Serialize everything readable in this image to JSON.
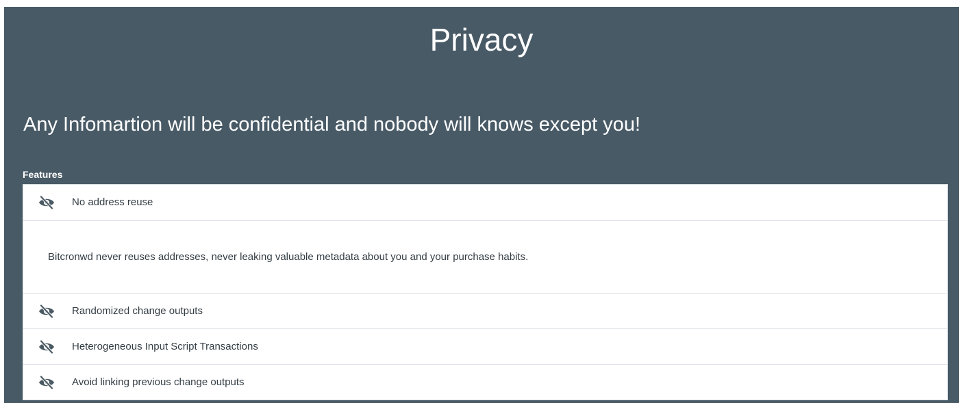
{
  "header": {
    "title": "Privacy",
    "subtitle": "Any Infomartion will be confidential and nobody will knows except you!"
  },
  "features": {
    "label": "Features",
    "icon": "eye-slash-icon",
    "items": [
      {
        "label": "No address reuse",
        "expanded": true,
        "description": "Bitcronwd never reuses addresses, never leaking valuable metadata about you and your purchase habits."
      },
      {
        "label": "Randomized change outputs",
        "expanded": false
      },
      {
        "label": "Heterogeneous Input Script Transactions",
        "expanded": false
      },
      {
        "label": "Avoid linking previous change outputs",
        "expanded": false
      }
    ]
  },
  "colors": {
    "background": "#485a66",
    "panel": "#ffffff",
    "text_light": "#ffffff",
    "text_dark": "#333d44",
    "icon": "#4a5a64"
  }
}
